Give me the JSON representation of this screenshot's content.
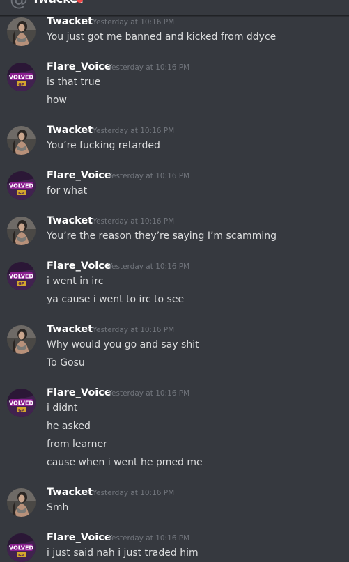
{
  "header": {
    "channel_name": "Twacket",
    "status_color": "#f04747",
    "icon": "at-icon"
  },
  "avatar_logo_text": {
    "line1": "VOLVED",
    "line2": "GP"
  },
  "messages": [
    {
      "author": "Twacket",
      "avatar": "twacket-avatar",
      "timestamp": "Yesterday at 10:16 PM",
      "lines": [
        "You just got me banned and kicked from ddyce"
      ]
    },
    {
      "author": "Flare_Voice",
      "avatar": "flare-avatar",
      "timestamp": "Yesterday at 10:16 PM",
      "lines": [
        "is that true",
        "how"
      ]
    },
    {
      "author": "Twacket",
      "avatar": "twacket-avatar",
      "timestamp": "Yesterday at 10:16 PM",
      "lines": [
        "You’re fucking retarded"
      ]
    },
    {
      "author": "Flare_Voice",
      "avatar": "flare-avatar",
      "timestamp": "Yesterday at 10:16 PM",
      "lines": [
        "for what"
      ]
    },
    {
      "author": "Twacket",
      "avatar": "twacket-avatar",
      "timestamp": "Yesterday at 10:16 PM",
      "lines": [
        "You’re the reason they’re saying I’m scamming"
      ]
    },
    {
      "author": "Flare_Voice",
      "avatar": "flare-avatar",
      "timestamp": "Yesterday at 10:16 PM",
      "lines": [
        "i went in irc",
        "ya cause i went to irc to see"
      ]
    },
    {
      "author": "Twacket",
      "avatar": "twacket-avatar",
      "timestamp": "Yesterday at 10:16 PM",
      "lines": [
        "Why would you go and say shit",
        "To Gosu"
      ]
    },
    {
      "author": "Flare_Voice",
      "avatar": "flare-avatar",
      "timestamp": "Yesterday at 10:16 PM",
      "lines": [
        "i didnt",
        "he asked",
        "from learner",
        "cause when i went he pmed me"
      ]
    },
    {
      "author": "Twacket",
      "avatar": "twacket-avatar",
      "timestamp": "Yesterday at 10:16 PM",
      "lines": [
        "Smh"
      ]
    },
    {
      "author": "Flare_Voice",
      "avatar": "flare-avatar",
      "timestamp": "Yesterday at 10:16 PM",
      "lines": [
        "i just said nah i just traded him"
      ]
    }
  ]
}
